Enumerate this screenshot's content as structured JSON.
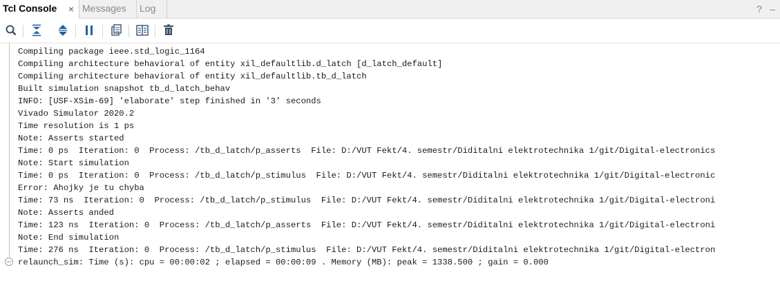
{
  "tabs": [
    {
      "label": "Tcl Console",
      "active": true
    },
    {
      "label": "Messages",
      "active": false
    },
    {
      "label": "Log",
      "active": false
    }
  ],
  "tab_close_glyph": "×",
  "window_controls": {
    "help": "?",
    "minimize": "–"
  },
  "toolbar": {
    "icons": [
      "search-icon",
      "collapse-all-icon",
      "expand-all-icon",
      "pause-icon",
      "copy-icon",
      "split-view-icon",
      "delete-icon"
    ]
  },
  "console": {
    "lines": [
      "Compiling package ieee.std_logic_1164",
      "Compiling architecture behavioral of entity xil_defaultlib.d_latch [d_latch_default]",
      "Compiling architecture behavioral of entity xil_defaultlib.tb_d_latch",
      "Built simulation snapshot tb_d_latch_behav",
      "INFO: [USF-XSim-69] 'elaborate' step finished in '3' seconds",
      "Vivado Simulator 2020.2",
      "Time resolution is 1 ps",
      "Note: Asserts started",
      "Time: 0 ps  Iteration: 0  Process: /tb_d_latch/p_asserts  File: D:/VUT Fekt/4. semestr/Diditalni elektrotechnika 1/git/Digital-electronics",
      "Note: Start simulation",
      "Time: 0 ps  Iteration: 0  Process: /tb_d_latch/p_stimulus  File: D:/VUT Fekt/4. semestr/Diditalni elektrotechnika 1/git/Digital-electronic",
      "Error: Ahojky je tu chyba",
      "Time: 73 ns  Iteration: 0  Process: /tb_d_latch/p_stimulus  File: D:/VUT Fekt/4. semestr/Diditalni elektrotechnika 1/git/Digital-electroni",
      "Note: Asserts anded",
      "Time: 123 ns  Iteration: 0  Process: /tb_d_latch/p_asserts  File: D:/VUT Fekt/4. semestr/Diditalni elektrotechnika 1/git/Digital-electroni",
      "Note: End simulation",
      "Time: 276 ns  Iteration: 0  Process: /tb_d_latch/p_stimulus  File: D:/VUT Fekt/4. semestr/Diditalni elektrotechnika 1/git/Digital-electron",
      "relaunch_sim: Time (s): cpu = 00:00:02 ; elapsed = 00:00:09 . Memory (MB): peak = 1338.500 ; gain = 0.000"
    ]
  },
  "colors": {
    "icon_blue": "#1f5fa8",
    "icon_dark": "#3a4d66"
  }
}
